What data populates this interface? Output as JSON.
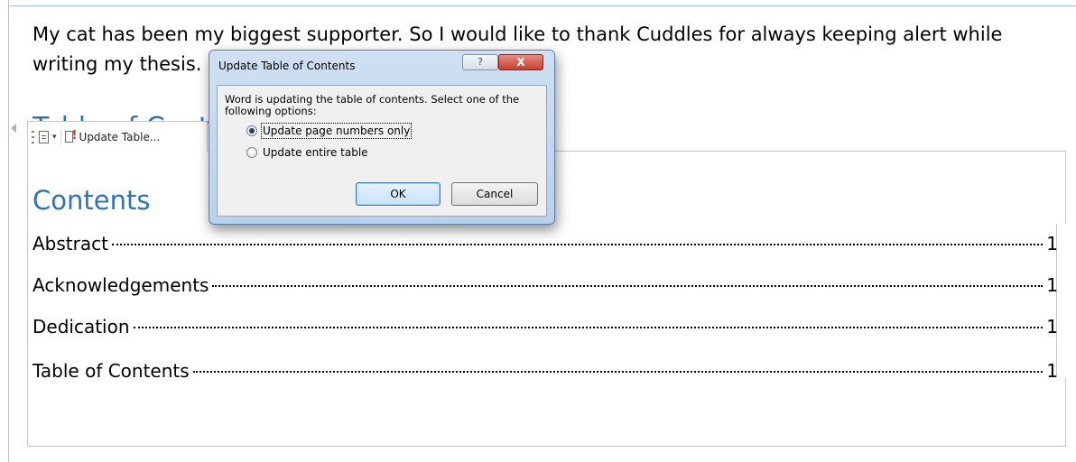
{
  "document": {
    "paragraph_line1": "My cat has been my biggest supporter.  So I would like to thank Cuddles for always keeping alert while",
    "paragraph_line2": "writing my thesis.",
    "section_heading": "Table of Contents",
    "contents_heading": "Contents",
    "toc_entries": [
      {
        "title": "Abstract",
        "page": "1"
      },
      {
        "title": "Acknowledgements",
        "page": "1"
      },
      {
        "title": "Dedication",
        "page": "1"
      },
      {
        "title": "Table of Contents",
        "page": "1"
      }
    ],
    "heading_color": "#2e74b5"
  },
  "toc_toolbar": {
    "update_table_label": "Update Table...",
    "icons": [
      "toc-icon",
      "chevron-down-icon",
      "update-table-icon"
    ]
  },
  "dialog": {
    "title": "Update Table of Contents",
    "help_glyph": "?",
    "close_glyph": "X",
    "message": "Word is updating the table of contents.  Select one of the following options:",
    "options": [
      {
        "label": "Update page numbers only",
        "checked": true
      },
      {
        "label": "Update entire table",
        "checked": false
      }
    ],
    "ok_label": "OK",
    "cancel_label": "Cancel"
  }
}
